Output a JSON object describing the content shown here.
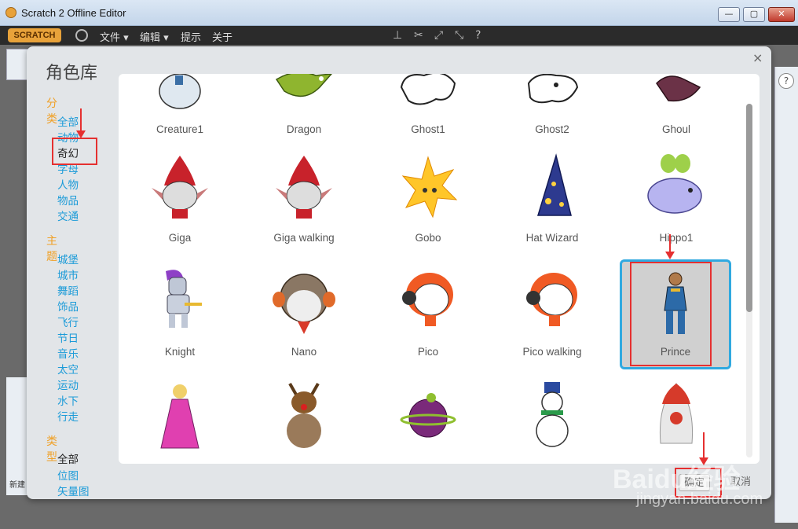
{
  "window": {
    "title": "Scratch 2 Offline Editor"
  },
  "menubar": {
    "logo": "SCRATCH",
    "items": [
      "文件 ▾",
      "编辑 ▾",
      "提示",
      "关于"
    ]
  },
  "library": {
    "title": "角色库",
    "category_head": "分类",
    "categories": [
      "全部",
      "动物",
      "奇幻",
      "字母",
      "人物",
      "物品",
      "交通"
    ],
    "theme_head": "主题",
    "themes": [
      "城堡",
      "城市",
      "舞蹈",
      "饰品",
      "飞行",
      "节日",
      "音乐",
      "太空",
      "运动",
      "水下",
      "行走"
    ],
    "type_head": "类型",
    "types": [
      "全部",
      "位图",
      "矢量图"
    ],
    "sprites": [
      "Creature1",
      "Dragon",
      "Ghost1",
      "Ghost2",
      "Ghoul",
      "Giga",
      "Giga walking",
      "Gobo",
      "Hat Wizard",
      "Hippo1",
      "Knight",
      "Nano",
      "Pico",
      "Pico walking",
      "Prince"
    ],
    "ok_label": "确定",
    "cancel_label": "取消",
    "close_label": "×"
  },
  "watermark": {
    "brand": "Baidu经验",
    "url": "jingyan.baidu.com"
  },
  "bg": {
    "left_label": "新建"
  }
}
